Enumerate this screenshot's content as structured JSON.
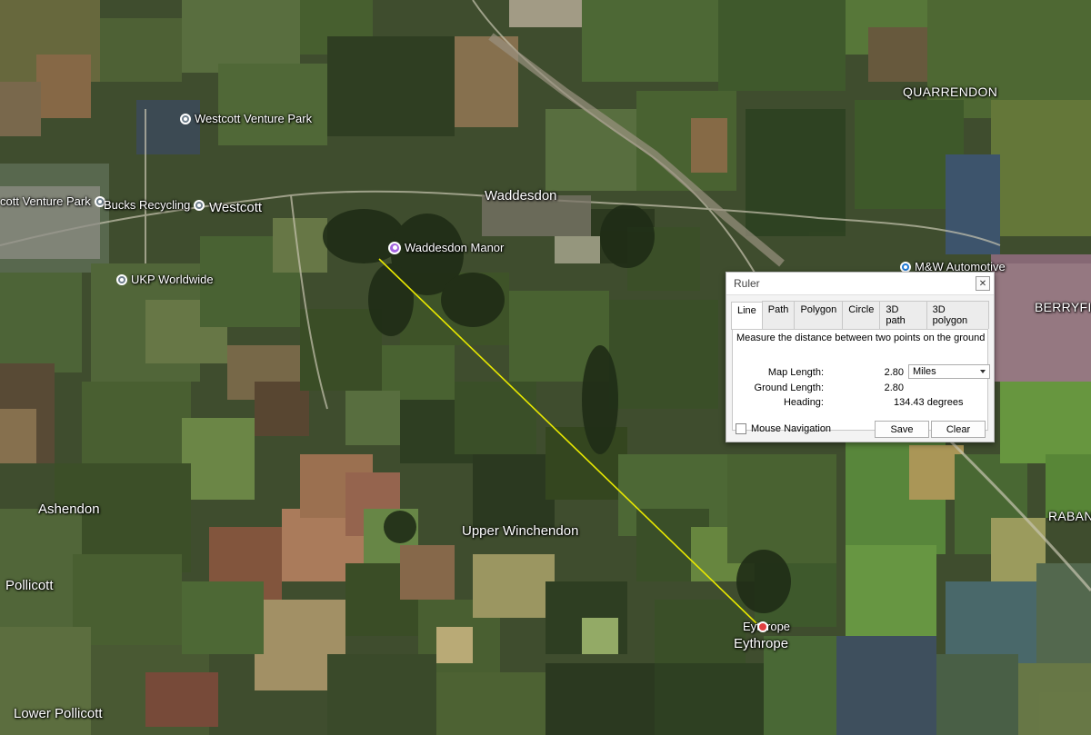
{
  "map": {
    "labels": {
      "quarrendon": "QUARRENDON",
      "waddesdon": "Waddesdon",
      "westcott": "Westcott",
      "berryfield": "BERRYFI",
      "ashendon": "Ashendon",
      "upper_winchendon": "Upper Winchendon",
      "pollicott": "Pollicott",
      "lower_pollicott": "Lower Pollicott",
      "raban": "RABAN",
      "eythrope_big": "Eythrope"
    },
    "pois": {
      "westcott_venture_park_1": "Westcott Venture Park",
      "westcott_venture_park_2": "cott Venture Park",
      "bucks_recycling": "Bucks Recycling",
      "ukp_worldwide": "UKP Worldwide",
      "waddesdon_manor": "Waddesdon Manor",
      "mw_automotive": "M&W Automotive",
      "eythrope": "Eythrope"
    },
    "measure_line_color": "#e8e800"
  },
  "ruler": {
    "title": "Ruler",
    "tabs": [
      "Line",
      "Path",
      "Polygon",
      "Circle",
      "3D path",
      "3D polygon"
    ],
    "active_tab": "Line",
    "description": "Measure the distance between two points on the ground",
    "map_length_label": "Map Length:",
    "map_length_value": "2.80",
    "units": "Miles",
    "ground_length_label": "Ground Length:",
    "ground_length_value": "2.80",
    "heading_label": "Heading:",
    "heading_value": "134.43 degrees",
    "mouse_navigation_label": "Mouse Navigation",
    "save_label": "Save",
    "clear_label": "Clear"
  }
}
